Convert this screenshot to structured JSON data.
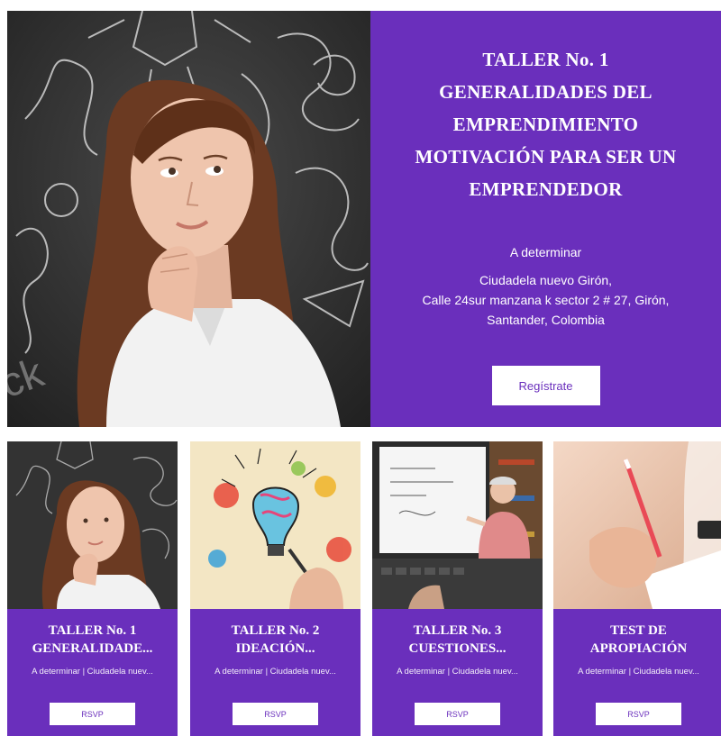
{
  "hero": {
    "title_lines": [
      "TALLER No. 1",
      "GENERALIDADES DEL",
      "EMPRENDIMIENTO",
      "MOTIVACIÓN PARA SER UN",
      "EMPRENDEDOR"
    ],
    "date": "A determinar",
    "address_lines": [
      "Ciudadela nuevo Girón,",
      "Calle 24sur manzana k sector 2 # 27, Girón,",
      "Santander, Colombia"
    ],
    "button_label": "Regístrate",
    "image_icon": "thinking-woman-illustration",
    "watermark_text": "ck"
  },
  "cards": [
    {
      "title_lines": [
        "TALLER No. 1",
        "GENERALIDADE..."
      ],
      "meta": "A determinar  |  Ciudadela nuev...",
      "button_label": "RSVP",
      "image_icon": "thinking-woman-thumbnail"
    },
    {
      "title_lines": [
        "TALLER No. 2",
        "IDEACIÓN..."
      ],
      "meta": "A determinar  |  Ciudadela nuev...",
      "button_label": "RSVP",
      "image_icon": "lightbulb-drawing-thumbnail"
    },
    {
      "title_lines": [
        "TALLER No. 3",
        "CUESTIONES..."
      ],
      "meta": "A determinar  |  Ciudadela nuev...",
      "button_label": "RSVP",
      "image_icon": "teacher-whiteboard-thumbnail"
    },
    {
      "title_lines": [
        "TEST DE",
        "APROPIACIÓN"
      ],
      "meta": "A determinar  |  Ciudadela nuev...",
      "button_label": "RSVP",
      "image_icon": "hand-writing-thumbnail"
    }
  ],
  "colors": {
    "accent": "#6a2fbc",
    "panel_text": "#ffffff",
    "button_bg": "#ffffff"
  }
}
